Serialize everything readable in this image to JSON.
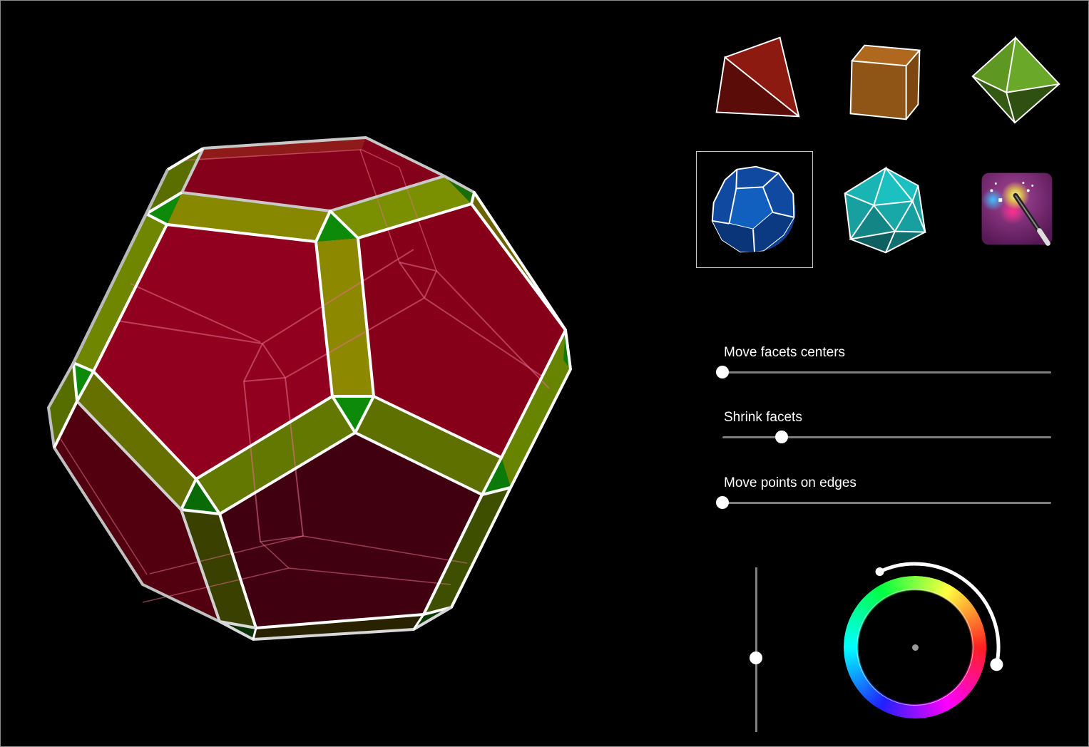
{
  "app": {
    "view": "3D polyhedron viewer",
    "current_solid": "dodecahedron"
  },
  "solids": [
    {
      "id": "tetrahedron",
      "label": "Tetrahedron",
      "color": "#8b1a12",
      "selected": false
    },
    {
      "id": "cube",
      "label": "Cube",
      "color": "#a8621c",
      "selected": false
    },
    {
      "id": "octahedron",
      "label": "Octahedron",
      "color": "#5e9e22",
      "selected": false
    },
    {
      "id": "dodecahedron",
      "label": "Dodecahedron",
      "color": "#1150b0",
      "selected": true
    },
    {
      "id": "icosahedron",
      "label": "Icosahedron",
      "color": "#1aa8a8",
      "selected": false
    },
    {
      "id": "magic",
      "label": "Magic wand",
      "color": "#8a2a8a",
      "selected": false
    }
  ],
  "sliders": [
    {
      "id": "move-facets-centers",
      "label": "Move facets centers",
      "value": 0.0
    },
    {
      "id": "shrink-facets",
      "label": "Shrink facets",
      "value": 0.18
    },
    {
      "id": "move-points-on-edges",
      "label": "Move points on edges",
      "value": 0.0
    }
  ],
  "brightness_slider": {
    "value": 0.45
  },
  "hue_picker": {
    "range_start_deg": -12,
    "range_end_deg": 115,
    "colors": {
      "face": "#8b001e",
      "edge_band": "#888800",
      "vertex_triangle": "#0e8a0a"
    }
  },
  "polyhedron": {
    "face_color": "#8b001e",
    "band_color": "#888800",
    "triangle_color": "#0e8a0a",
    "edge_color": "#ffffff"
  }
}
